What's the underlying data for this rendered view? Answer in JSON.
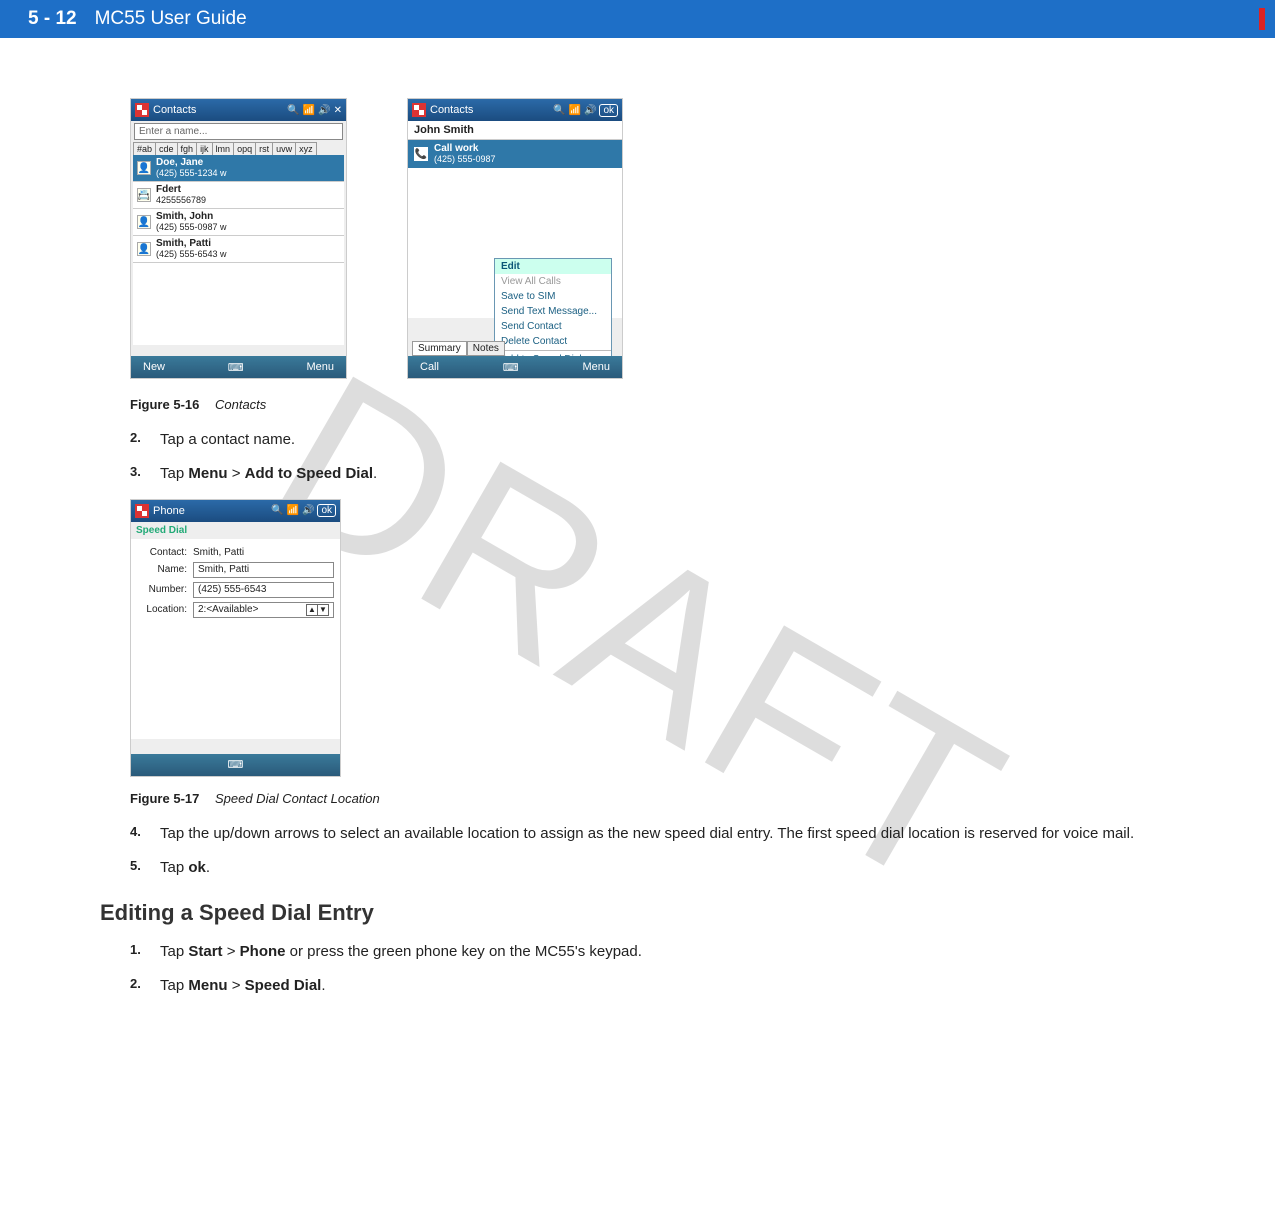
{
  "header": {
    "page_number": "5 - 12",
    "title": "MC55 User Guide"
  },
  "watermark": "DRAFT",
  "fig16": {
    "caption_num": "Figure 5-16",
    "caption_title": "Contacts",
    "left": {
      "titlebar": "Contacts",
      "close_glyph": "✕",
      "name_placeholder": "Enter a name...",
      "index_tabs": [
        "#ab",
        "cde",
        "fgh",
        "ijk",
        "lmn",
        "opq",
        "rst",
        "uvw",
        "xyz"
      ],
      "rows": [
        {
          "name": "Doe, Jane",
          "sub": "(425) 555-1234  w",
          "sel": true
        },
        {
          "name": "Fdert",
          "sub": "4255556789",
          "sel": false
        },
        {
          "name": "Smith, John",
          "sub": "(425) 555-0987  w",
          "sel": false
        },
        {
          "name": "Smith, Patti",
          "sub": "(425) 555-6543  w",
          "sel": false
        }
      ],
      "bottom_left": "New",
      "bottom_right": "Menu"
    },
    "right": {
      "titlebar": "Contacts",
      "ok_label": "ok",
      "contact_name": "John Smith",
      "call_label": "Call work",
      "call_sub": "(425) 555-0987",
      "tabs": {
        "summary": "Summary",
        "notes": "Notes"
      },
      "menu": {
        "edit": "Edit",
        "view_all": "View All Calls",
        "save_sim": "Save to SIM",
        "send_text": "Send Text Message...",
        "send_contact": "Send Contact",
        "delete_contact": "Delete Contact",
        "add_speed": "Add to Speed Dial..."
      },
      "bottom_left": "Call",
      "bottom_right": "Menu"
    }
  },
  "step2": {
    "num": "2.",
    "body_pre": "Tap a contact name."
  },
  "step3": {
    "num": "3.",
    "pre": "Tap ",
    "b1": "Menu",
    "gt": " > ",
    "b2": "Add to Speed Dial",
    "post": "."
  },
  "fig17": {
    "caption_num": "Figure 5-17",
    "caption_title": "Speed Dial Contact Location",
    "titlebar": "Phone",
    "ok_label": "ok",
    "section": "Speed Dial",
    "fields": {
      "contact_label": "Contact:",
      "contact_value": "Smith, Patti",
      "name_label": "Name:",
      "name_value": "Smith, Patti",
      "number_label": "Number:",
      "number_value": "(425) 555-6543",
      "location_label": "Location:",
      "location_value": "2:<Available>"
    }
  },
  "step4": {
    "num": "4.",
    "body": "Tap the up/down arrows to select an available location to assign as the new speed dial entry. The first speed dial location is reserved for voice mail."
  },
  "step5": {
    "num": "5.",
    "pre": "Tap ",
    "b1": "ok",
    "post": "."
  },
  "heading": "Editing a Speed Dial Entry",
  "edit_step1": {
    "num": "1.",
    "pre": "Tap ",
    "b1": "Start",
    "gt1": " > ",
    "b2": "Phone",
    "post": " or press the green phone key on the MC55's keypad."
  },
  "edit_step2": {
    "num": "2.",
    "pre": "Tap ",
    "b1": "Menu",
    "gt1": " > ",
    "b2": "Speed Dial",
    "post": "."
  }
}
